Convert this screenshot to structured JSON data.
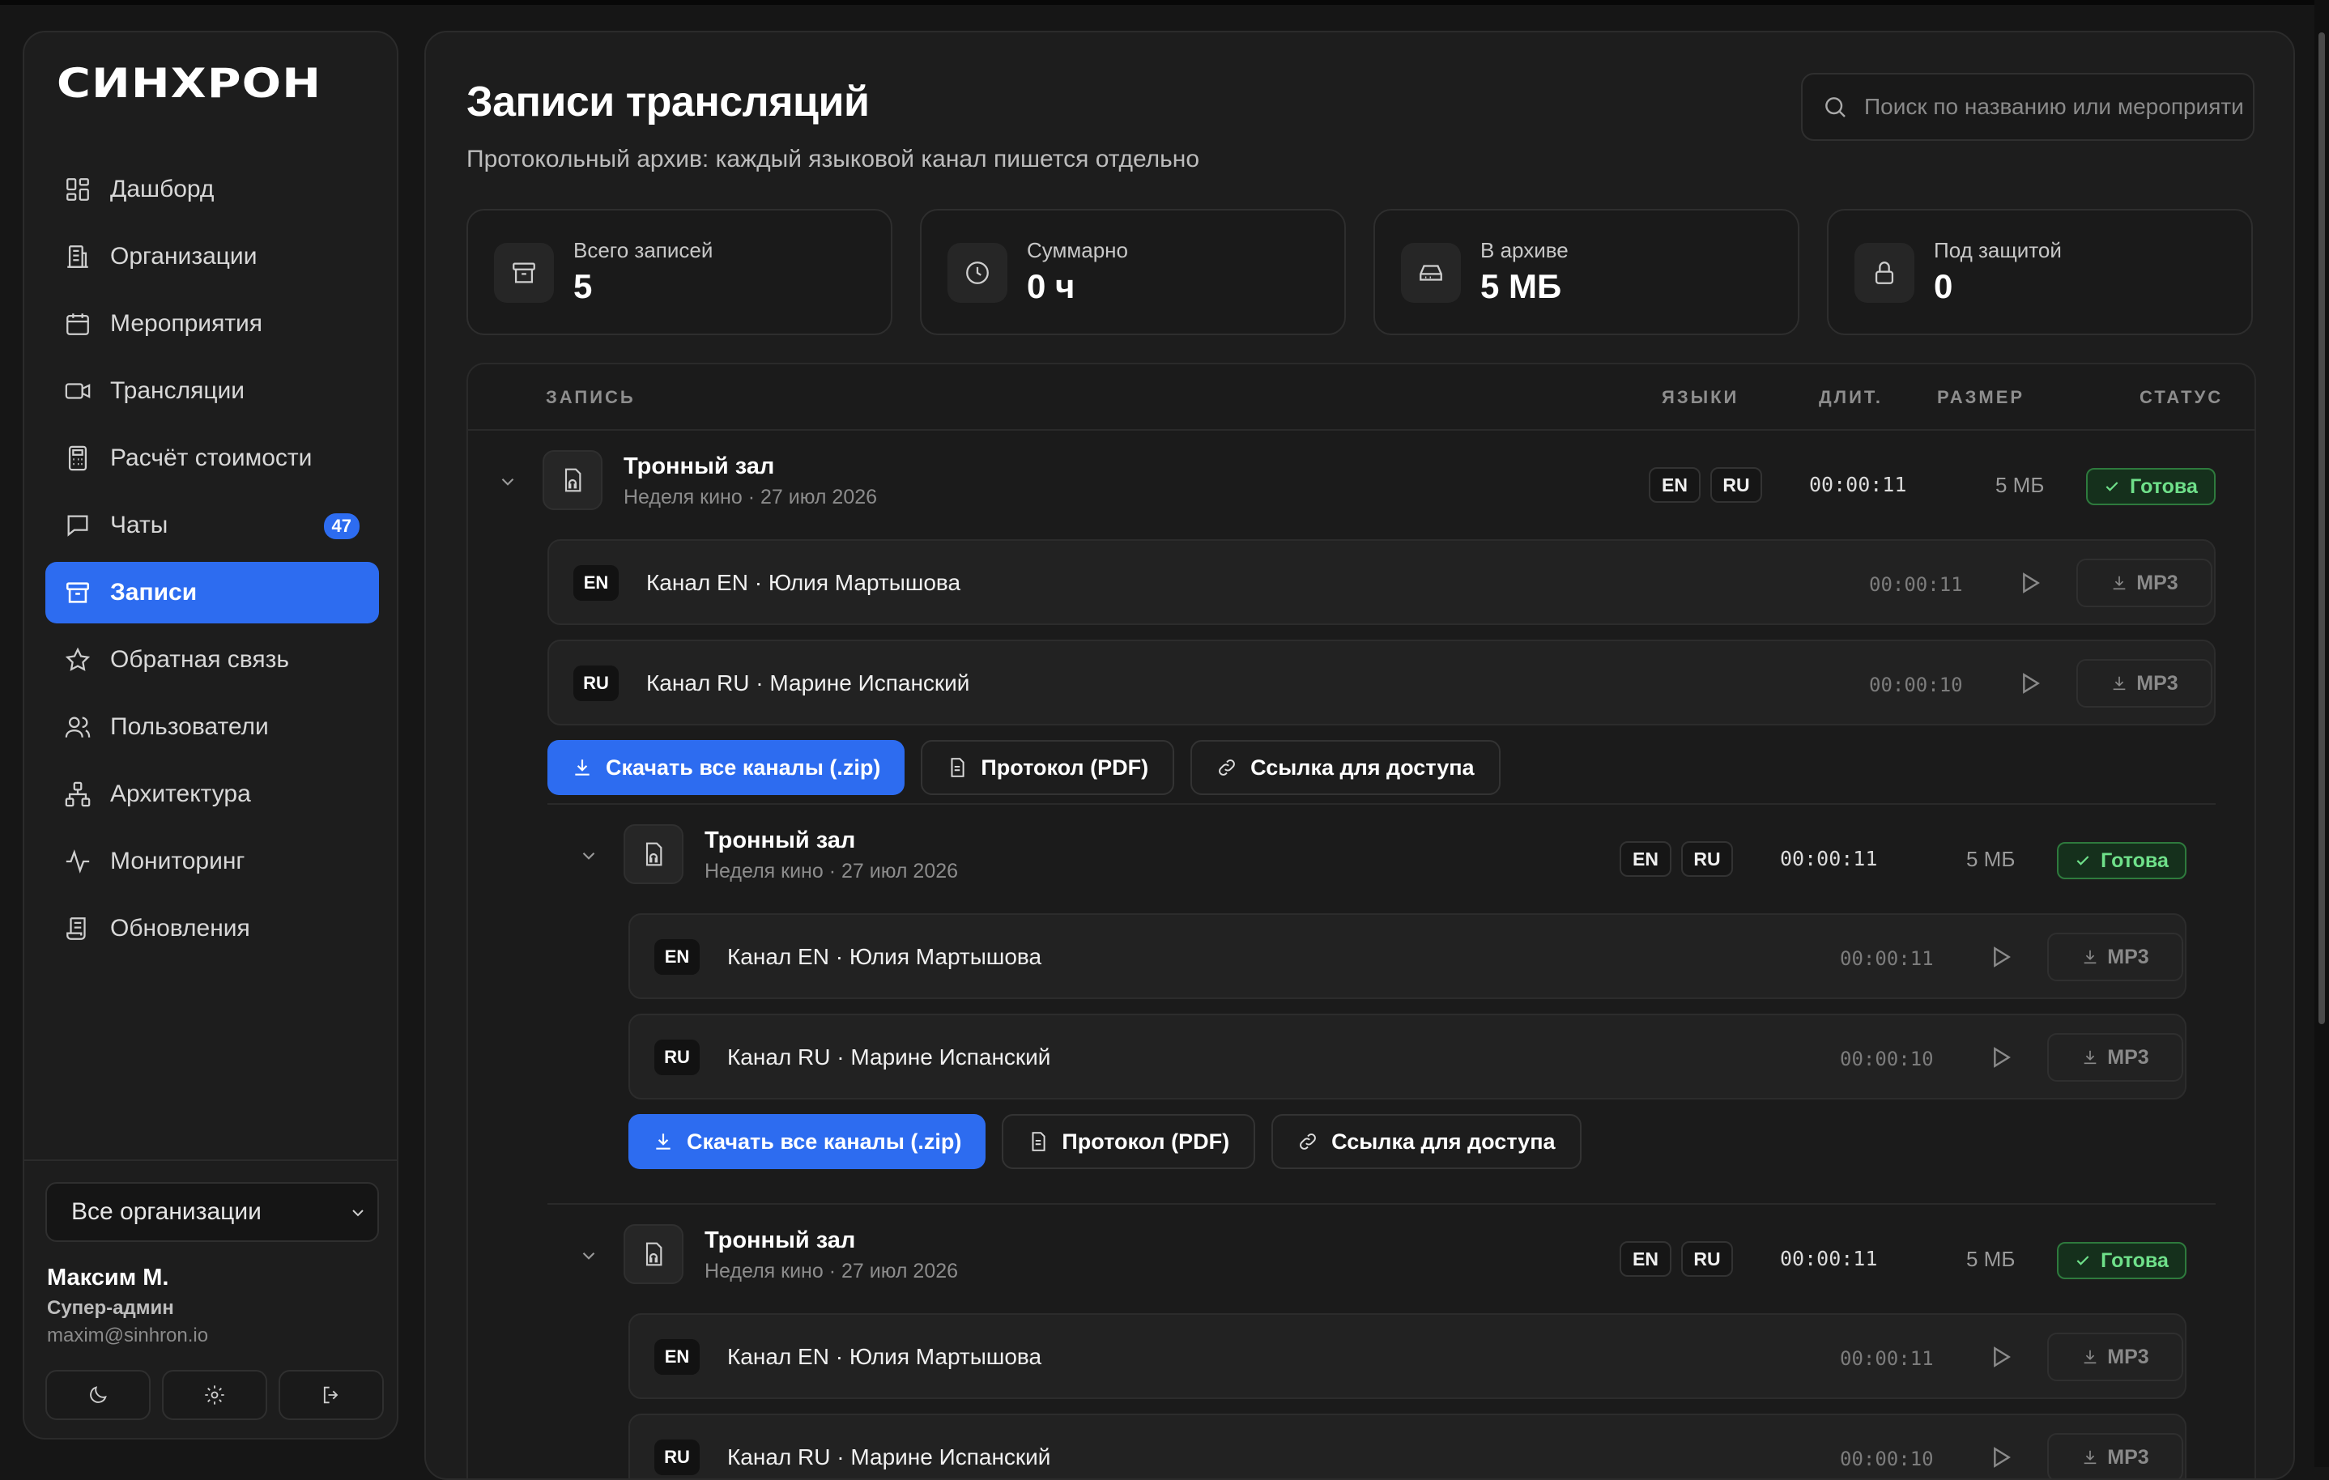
{
  "app": {
    "logo": "СИНХРОН"
  },
  "sidebar": {
    "items": [
      {
        "label": "Дашборд",
        "icon": "dashboard-icon"
      },
      {
        "label": "Организации",
        "icon": "building-icon"
      },
      {
        "label": "Мероприятия",
        "icon": "calendar-icon"
      },
      {
        "label": "Трансляции",
        "icon": "video-icon"
      },
      {
        "label": "Расчёт стоимости",
        "icon": "calculator-icon"
      },
      {
        "label": "Чаты",
        "icon": "chat-icon",
        "badge": "47"
      },
      {
        "label": "Записи",
        "icon": "archive-icon",
        "active": true
      },
      {
        "label": "Обратная связь",
        "icon": "star-icon"
      },
      {
        "label": "Пользователи",
        "icon": "users-icon"
      },
      {
        "label": "Архитектура",
        "icon": "hierarchy-icon"
      },
      {
        "label": "Мониторинг",
        "icon": "pulse-icon"
      },
      {
        "label": "Обновления",
        "icon": "scroll-icon"
      }
    ],
    "org_select": "Все организации",
    "user": {
      "name": "Максим М.",
      "role": "Супер-админ",
      "email": "maxim@sinhron.io"
    }
  },
  "header": {
    "title": "Записи трансляций",
    "subtitle": "Протокольный архив: каждый языковой канал пишется отдельно",
    "search_placeholder": "Поиск по названию или мероприятию"
  },
  "stats": [
    {
      "label": "Всего записей",
      "value": "5",
      "icon": "archive-icon"
    },
    {
      "label": "Суммарно",
      "value": "0 ч",
      "icon": "clock-icon"
    },
    {
      "label": "В архиве",
      "value": "5 МБ",
      "icon": "hard-drive-icon"
    },
    {
      "label": "Под защитой",
      "value": "0",
      "icon": "lock-icon"
    }
  ],
  "table": {
    "headers": {
      "record": "ЗАПИСЬ",
      "languages": "ЯЗЫКИ",
      "duration": "ДЛИТ.",
      "size": "РАЗМЕР",
      "status": "СТАТУС"
    },
    "records": [
      {
        "title": "Тронный зал",
        "meta": "Неделя кино · 27 июл 2026",
        "langs": [
          "EN",
          "RU"
        ],
        "duration": "00:00:11",
        "size": "5 МБ",
        "status": "Готова",
        "channels": [
          {
            "tag": "EN",
            "name": "Канал EN · Юлия Мартышова",
            "duration": "00:00:11",
            "format": "MP3"
          },
          {
            "tag": "RU",
            "name": "Канал RU · Марине Испанский",
            "duration": "00:00:10",
            "format": "MP3"
          }
        ],
        "actions": {
          "download_all": "Скачать все каналы (.zip)",
          "protocol": "Протокол (PDF)",
          "share": "Ссылка для доступа"
        }
      },
      {
        "title": "Тронный зал",
        "meta": "Неделя кино · 27 июл 2026",
        "langs": [
          "EN",
          "RU"
        ],
        "duration": "00:00:11",
        "size": "5 МБ",
        "status": "Готова",
        "channels": [
          {
            "tag": "EN",
            "name": "Канал EN · Юлия Мартышова",
            "duration": "00:00:11",
            "format": "MP3"
          },
          {
            "tag": "RU",
            "name": "Канал RU · Марине Испанский",
            "duration": "00:00:10",
            "format": "MP3"
          }
        ],
        "actions": {
          "download_all": "Скачать все каналы (.zip)",
          "protocol": "Протокол (PDF)",
          "share": "Ссылка для доступа"
        }
      },
      {
        "title": "Тронный зал",
        "meta": "Неделя кино · 27 июл 2026",
        "langs": [
          "EN",
          "RU"
        ],
        "duration": "00:00:11",
        "size": "5 МБ",
        "status": "Готова",
        "channels": [
          {
            "tag": "EN",
            "name": "Канал EN · Юлия Мартышова",
            "duration": "00:00:11",
            "format": "MP3"
          },
          {
            "tag": "RU",
            "name": "Канал RU · Марине Испанский",
            "duration": "00:00:10",
            "format": "MP3"
          }
        ]
      }
    ]
  },
  "colors": {
    "accent": "#2d6cf0",
    "status_ready": "#6fe08a",
    "background": "#161616",
    "panel": "#1d1d1d"
  }
}
